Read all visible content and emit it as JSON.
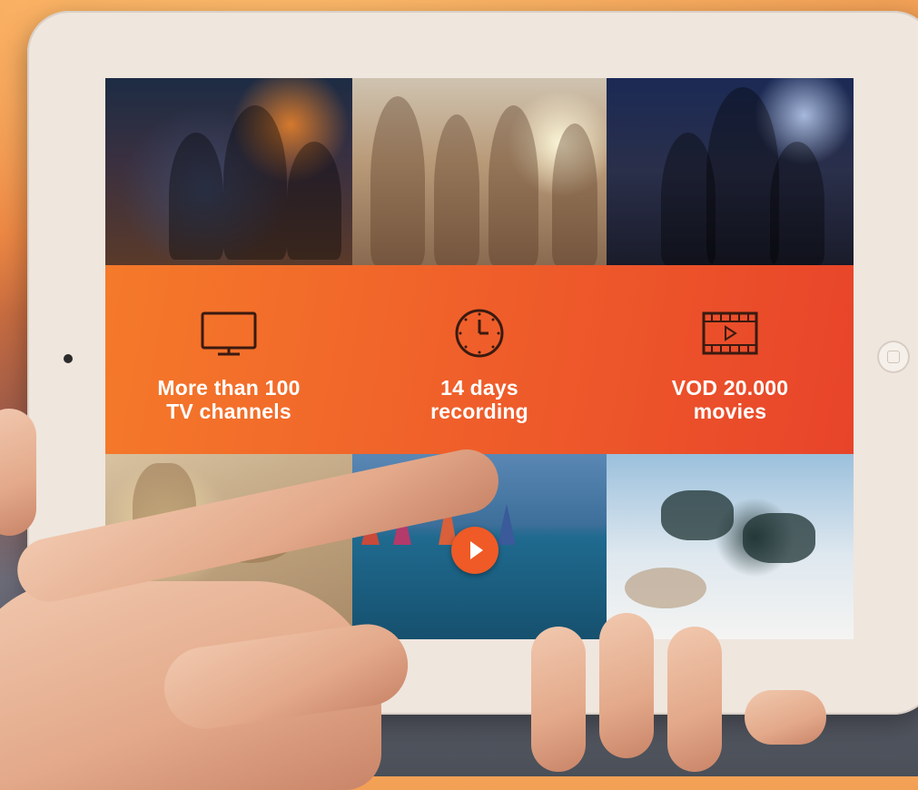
{
  "features": [
    {
      "icon": "tv-icon",
      "line1": "More than 100",
      "line2": "TV channels"
    },
    {
      "icon": "clock-icon",
      "line1": "14 days",
      "line2": "recording"
    },
    {
      "icon": "film-icon",
      "line1": "VOD 20.000",
      "line2": "movies"
    }
  ],
  "tiles": {
    "top": [
      "fantasy-movie-poster",
      "beach-party-photo",
      "football-team-poster"
    ],
    "bottom": [
      "seashells-on-sand-photo",
      "windsurfing-video-thumbnail",
      "sunglasses-on-beach-photo"
    ]
  },
  "colors": {
    "accent": "#ef5a26",
    "banner_start": "#f57a2a",
    "banner_end": "#e8442a",
    "device": "#efe6de"
  }
}
